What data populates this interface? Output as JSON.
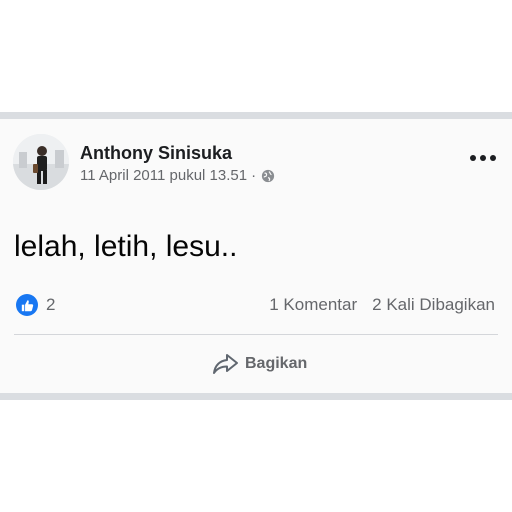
{
  "post": {
    "author_name": "Anthony Sinisuka",
    "timestamp": "11 April 2011 pukul 13.51",
    "separator": "·",
    "privacy_icon": "globe-icon",
    "text": "lelah, letih, lesu..",
    "reactions": {
      "icon": "like-icon",
      "count": "2"
    },
    "comments_label": "1 Komentar",
    "shares_label": "2 Kali Dibagikan",
    "share_button_label": "Bagikan",
    "share_button_icon": "share-arrow-icon",
    "menu_icon": "more-options-icon"
  },
  "colors": {
    "accent": "#1877f2",
    "secondary_text": "#65676b",
    "primary_text": "#1c1e21",
    "separator_band": "#dadde1"
  }
}
